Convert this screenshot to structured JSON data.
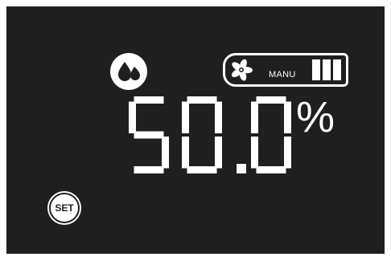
{
  "display": {
    "reading": "50.0",
    "unit": "%",
    "background_color": "#1f1f1f",
    "segment_color": "#ffffff"
  },
  "humidity_indicator": {
    "icon": "water-drops-icon"
  },
  "fan_status": {
    "icon": "fan-icon",
    "mode_label": "MANU",
    "speed_level": 3,
    "speed_max": 3
  },
  "controls": {
    "set_label": "SET"
  }
}
